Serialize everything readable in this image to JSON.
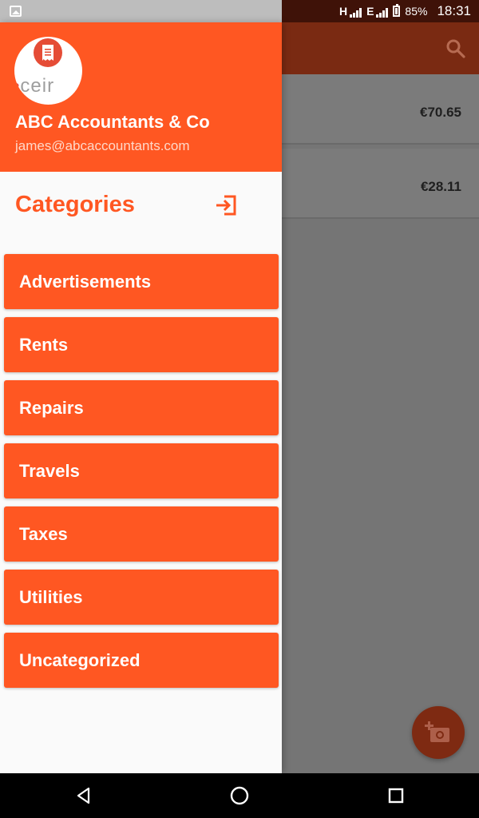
{
  "status_bar": {
    "net1": "H",
    "net2": "E",
    "battery": "85%",
    "time": "18:31",
    "icons": [
      "gallery-icon",
      "signal-icon",
      "battery-icon"
    ]
  },
  "background": {
    "cards": [
      {
        "amount": "€70.65"
      },
      {
        "amount": "€28.11"
      }
    ],
    "icons": [
      "search-icon",
      "add-photo-icon"
    ]
  },
  "drawer": {
    "account": {
      "name": "ABC Accountants & Co",
      "email": "james@abcaccountants.com",
      "logo_text_prefix": "",
      "logo_dot": "•",
      "logo_text": "ceir"
    },
    "categories_title": "Categories",
    "logout_icon": "logout-icon",
    "categories": [
      {
        "label": "Advertisements"
      },
      {
        "label": "Rents"
      },
      {
        "label": "Repairs"
      },
      {
        "label": "Travels"
      },
      {
        "label": "Taxes"
      },
      {
        "label": "Utilities"
      },
      {
        "label": "Uncategorized"
      }
    ]
  },
  "nav_bar": {
    "icons": [
      "back-icon",
      "home-icon",
      "recents-icon"
    ]
  },
  "colors": {
    "accent": "#ff5722",
    "header_bg": "#ff5722",
    "drawer_bg": "#fafafa",
    "scrim": "#757575"
  }
}
